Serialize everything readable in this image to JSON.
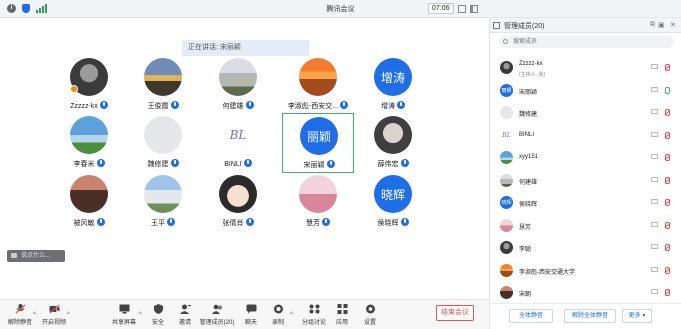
{
  "window": {
    "title": "腾讯会议",
    "timer": "07:06"
  },
  "speaking": "正在讲话: 宋丽颖",
  "chat_placeholder": "说点什么...",
  "participants": [
    {
      "name": "Zzzzz-kx",
      "avatar": "photo-dark",
      "host": true,
      "mic": "muted"
    },
    {
      "name": "王俊霞",
      "avatar": "photo-landscape",
      "mic": "muted"
    },
    {
      "name": "何建雄",
      "avatar": "photo-building",
      "mic": "muted"
    },
    {
      "name": "李淑彪-西安交...",
      "avatar": "photo-sunset",
      "mic": "muted"
    },
    {
      "name": "增涛",
      "avatar_text": "增涛",
      "mic": "muted"
    },
    {
      "name": "李春米",
      "avatar": "photo-sky",
      "mic": "muted"
    },
    {
      "name": "魏修建",
      "avatar": "default-gray",
      "mic": "muted"
    },
    {
      "name": "BINLI",
      "avatar": "logo-bl",
      "mic": "muted"
    },
    {
      "name": "宋丽颖",
      "avatar_text": "丽颖",
      "mic": "speaking",
      "active": true
    },
    {
      "name": "薛伟宏",
      "avatar": "photo-dog",
      "mic": "muted"
    },
    {
      "name": "被风敏",
      "avatar": "photo-person",
      "mic": "muted"
    },
    {
      "name": "王平",
      "avatar": "photo-campus",
      "mic": "muted"
    },
    {
      "name": "张倩肖",
      "avatar": "photo-cartoon",
      "mic": "muted"
    },
    {
      "name": "慧芳",
      "avatar": "photo-flowers",
      "mic": "muted"
    },
    {
      "name": "侯晓辉",
      "avatar_text": "晓辉",
      "mic": "muted"
    }
  ],
  "toolbar": {
    "unmute": "解除静音",
    "video": "开启视频",
    "share": "共享屏幕",
    "security": "安全",
    "invite": "邀请",
    "members": "管理成员(20)",
    "chat": "聊天",
    "record": "录制",
    "breakout": "分组讨论",
    "apps": "应用",
    "settings": "设置",
    "end": "结束会议"
  },
  "sidebar": {
    "title": "管理成员(20)",
    "search_placeholder": "搜索成员",
    "members": [
      {
        "name": "Zzzzz-kx",
        "sub": "(主持人, 我)",
        "avatar": "photo-dark",
        "mic": "muted"
      },
      {
        "name": "宋丽颖",
        "avatar_text": "丽颖",
        "mic": "on"
      },
      {
        "name": "魏修建",
        "avatar": "default-gray",
        "mic": "muted"
      },
      {
        "name": "BINLI",
        "avatar": "logo-bl",
        "mic": "muted"
      },
      {
        "name": "xyy151",
        "avatar": "photo-sky",
        "mic": "muted"
      },
      {
        "name": "何建雄",
        "avatar": "photo-building",
        "mic": "muted"
      },
      {
        "name": "侯晓辉",
        "avatar_text": "晓辉",
        "mic": "muted"
      },
      {
        "name": "慧芳",
        "avatar": "photo-flowers",
        "mic": "muted"
      },
      {
        "name": "李聪",
        "avatar": "photo-dark",
        "mic": "muted"
      },
      {
        "name": "李淑彪-西安交通大学",
        "avatar": "photo-sunset",
        "mic": "muted"
      },
      {
        "name": "宋朝",
        "avatar": "photo-person",
        "mic": "muted"
      }
    ],
    "footer": {
      "mute_all": "全体静音",
      "unmute_all": "解除全体静音",
      "more": "更多 ▾"
    }
  },
  "colors": {
    "accent": "#1f6ee8",
    "speaking_border": "#3cb76b",
    "danger": "#e4544d"
  }
}
